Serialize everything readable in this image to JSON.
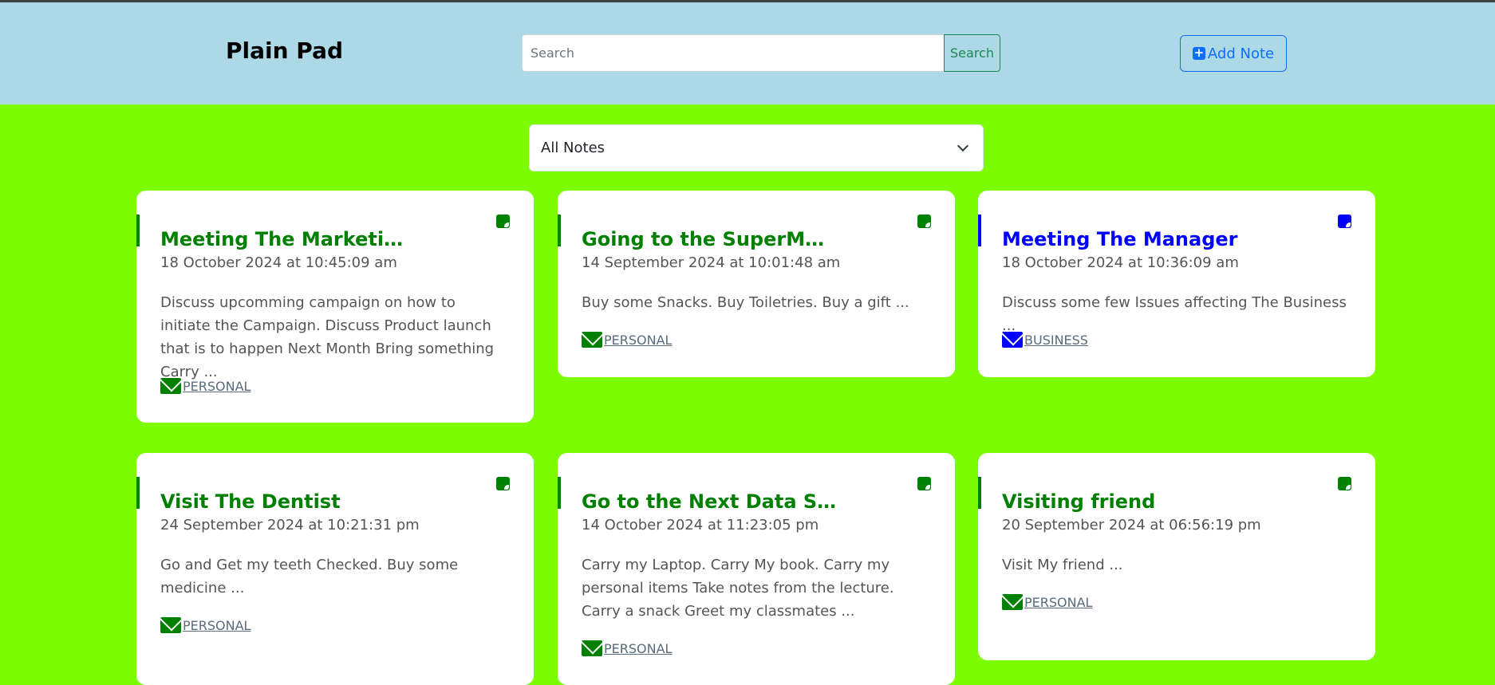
{
  "app": {
    "title": "Plain Pad"
  },
  "header": {
    "search_placeholder": "Search",
    "search_button": "Search",
    "add_note": "Add Note"
  },
  "filter": {
    "selected": "All Notes"
  },
  "colors": {
    "page_bg": "#7cfc00",
    "header_bg": "#add8e6",
    "personal": "#008000",
    "business": "#0000ff"
  },
  "notes": [
    {
      "title": "Meeting The Marketing Team",
      "date": "18 October 2024 at 10:45:09 am",
      "body": "Discuss upcomming campaign on how to initiate the Campaign. Discuss Product launch that is to happen Next Month Bring something Carry ...",
      "tag": "PERSONAL",
      "color": "#008000"
    },
    {
      "title": "Going to the SuperMarket",
      "date": "14 September 2024 at 10:01:48 am",
      "body": "Buy some Snacks. Buy Toiletries. Buy a gift ...",
      "tag": "PERSONAL",
      "color": "#008000"
    },
    {
      "title": "Meeting The Manager",
      "date": "18 October 2024 at 10:36:09 am",
      "body": "Discuss some few Issues affecting The Business ...",
      "tag": "BUSINESS",
      "color": "#0000ff"
    },
    {
      "title": "Visit The Dentist",
      "date": "24 September 2024 at 10:21:31 pm",
      "body": "Go and Get my teeth Checked. Buy some medicine ...",
      "tag": "PERSONAL",
      "color": "#008000"
    },
    {
      "title": "Go to the Next Data Struct...",
      "date": "14 October 2024 at 11:23:05 pm",
      "body": "Carry my Laptop. Carry My book. Carry my personal items Take notes from the lecture. Carry a snack Greet my classmates ...",
      "tag": "PERSONAL",
      "color": "#008000"
    },
    {
      "title": "Visiting friend",
      "date": "20 September 2024 at 06:56:19 pm",
      "body": "Visit My friend ...",
      "tag": "PERSONAL",
      "color": "#008000"
    }
  ]
}
